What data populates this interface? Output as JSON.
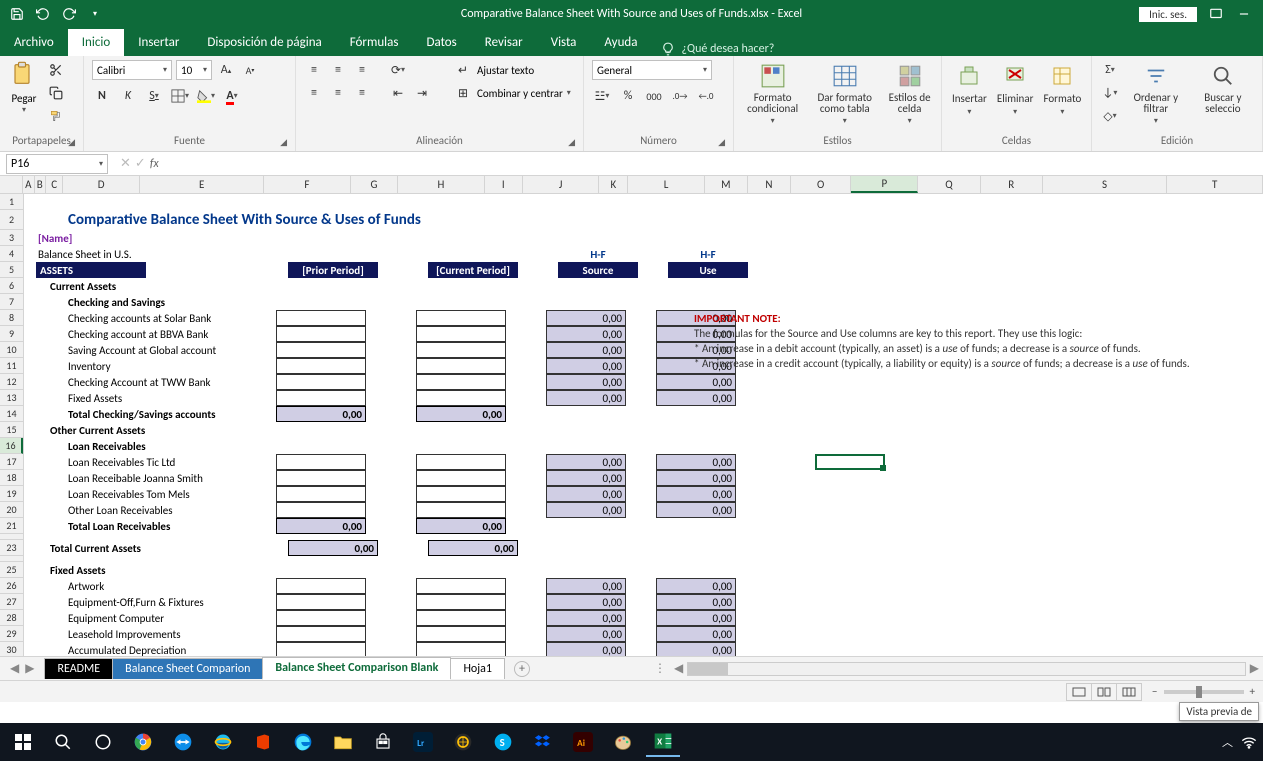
{
  "title": "Comparative Balance Sheet With Source and Uses of Funds.xlsx - Excel",
  "signin": "Inic. ses.",
  "menu": {
    "file": "Archivo",
    "home": "Inicio",
    "insert": "Insertar",
    "layout": "Disposición de página",
    "formulas": "Fórmulas",
    "data": "Datos",
    "review": "Revisar",
    "view": "Vista",
    "help": "Ayuda",
    "tellme": "¿Qué desea hacer?"
  },
  "ribbon": {
    "clipboard": {
      "label": "Portapapeles",
      "paste": "Pegar"
    },
    "font": {
      "label": "Fuente",
      "name": "Calibri",
      "size": "10"
    },
    "alignment": {
      "label": "Alineación",
      "wrap": "Ajustar texto",
      "merge": "Combinar y centrar"
    },
    "number": {
      "label": "Número",
      "format": "General"
    },
    "styles": {
      "label": "Estilos",
      "conditional": "Formato condicional",
      "table": "Dar formato como tabla",
      "cell": "Estilos de celda"
    },
    "cells": {
      "label": "Celdas",
      "insert": "Insertar",
      "delete": "Eliminar",
      "format": "Formato"
    },
    "editing": {
      "label": "Edición",
      "sort": "Ordenar y filtrar",
      "find": "Buscar y seleccio"
    }
  },
  "namebox": "P16",
  "columns": [
    "A",
    "B",
    "C",
    "D",
    "E",
    "F",
    "G",
    "H",
    "I",
    "J",
    "K",
    "L",
    "M",
    "N",
    "O",
    "P",
    "Q",
    "R",
    "S",
    "T"
  ],
  "sheet": {
    "title": "Comparative Balance Sheet With Source & Uses of Funds",
    "name_placeholder": "[Name]",
    "bs_us": "Balance Sheet in U.S.",
    "assets": "ASSETS",
    "prior": "[Prior Period]",
    "current": "[Current Period]",
    "hf1": "H-F",
    "source": "Source",
    "hf2": "H-F",
    "use": "Use",
    "ca": "Current Assets",
    "chksav": "Checking and Savings",
    "r8": "Checking accounts at Solar Bank",
    "r9": "Checking account at BBVA Bank",
    "r10": "Saving Account at Global account",
    "r11": "Inventory",
    "r12": "Checking Account at TWW Bank",
    "r13": "Fixed Assets",
    "r14": "Total Checking/Savings accounts",
    "oca": "Other Current Assets",
    "lr": "Loan Receivables",
    "r17": "Loan Receivables Tic Ltd",
    "r18": "Loan Receibable Joanna Smith",
    "r19": "Loan Receivables Tom Mels",
    "r20": "Other Loan Receivables",
    "r21": "Total Loan Receivables",
    "tca": "Total Current Assets",
    "fa": "Fixed Assets",
    "r26": "Artwork",
    "r27": "Equipment-Off,Furn & Fixtures",
    "r28": "Equipment Computer",
    "r29": "Leasehold Improvements",
    "r30": "Accumulated Depreciation",
    "zero": "0,00",
    "note_title": "IMPORTANT NOTE:",
    "note1": "The formulas for the Source and Use columns are key to this report. They use this logic:",
    "note2a": "* An increase in a debit account (typically, an asset) is a ",
    "note2b": "use",
    "note2c": " of funds; a decrease is a ",
    "note2d": "source",
    "note2e": " of funds.",
    "note3a": "* An increase in a credit account (typically, a liability or equity) is a ",
    "note3b": "source",
    "note3c": " of funds; a decrease is a ",
    "note3d": "use",
    "note3e": " of funds."
  },
  "tabs": {
    "readme": "README",
    "comp": "Balance Sheet Comparion",
    "blank": "Balance Sheet Comparison Blank",
    "hoja1": "Hoja1"
  },
  "preview": "Vista previa de"
}
